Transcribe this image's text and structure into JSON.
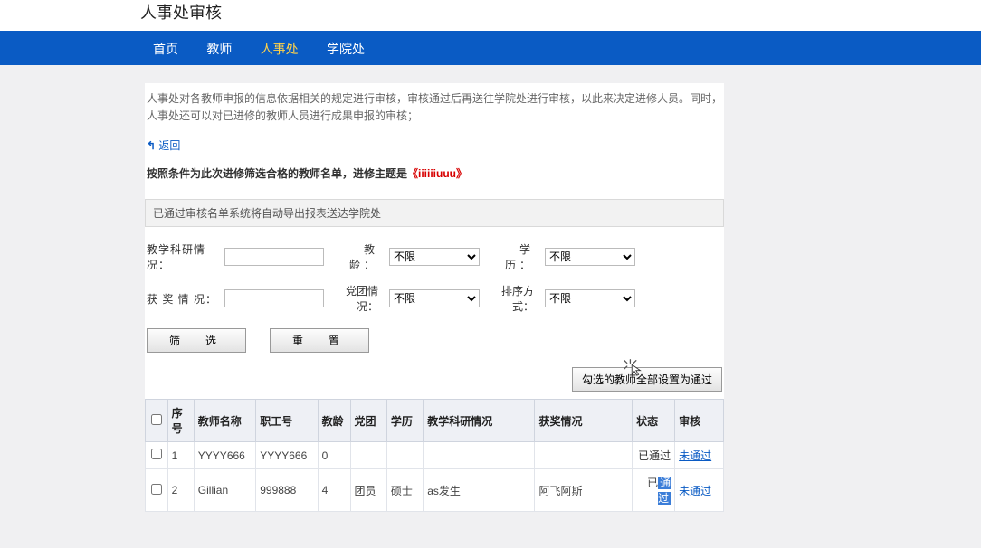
{
  "page_title": "人事处审核",
  "nav": [
    {
      "label": "首页",
      "active": false
    },
    {
      "label": "教师",
      "active": false
    },
    {
      "label": "人事处",
      "active": true
    },
    {
      "label": "学院处",
      "active": false
    }
  ],
  "description": "人事处对各教师申报的信息依据相关的规定进行审核，审核通过后再送往学院处进行审核，以此来决定进修人员。同时，人事处还可以对已进修的教师人员进行成果申报的审核；",
  "back_label": "返回",
  "rule_prefix": "按照条件为此次进修筛选合格的教师名单，进修主题是",
  "rule_highlight": "《iiiiiiuuu》",
  "note_line": "已通过审核名单系统将自动导出报表送达学院处",
  "filters": {
    "f1_label": "教学科研情况：",
    "f1_label2": "教　　龄：",
    "f1_value2": "不限",
    "f1_label3": "学　　历：",
    "f1_value3": "不限",
    "f2_label": "获 奖 情 况：",
    "f2_label2": "党团情况：",
    "f2_value2": "不限",
    "f2_label3": "排序方式：",
    "f2_value3": "不限"
  },
  "buttons": {
    "filter": "筛　选",
    "reset": "重　置",
    "set_pass": "勾选的教师全部设置为通过"
  },
  "table": {
    "headers": [
      "",
      "序号",
      "教师名称",
      "职工号",
      "教龄",
      "党团",
      "学历",
      "教学科研情况",
      "获奖情况",
      "状态",
      "审核"
    ],
    "rows": [
      {
        "idx": "1",
        "name": "YYYY666",
        "gh": "YYYY666",
        "age": "0",
        "dt": "",
        "xl": "",
        "jy": "",
        "hj": "",
        "status": "已通过",
        "audit": "未通过",
        "hl": false
      },
      {
        "idx": "2",
        "name": "Gillian",
        "gh": "999888",
        "age": "4",
        "dt": "团员",
        "xl": "硕士",
        "jy": "as发生",
        "hj": "阿飞阿斯",
        "status_prefix": "已",
        "status_hl": "通过",
        "audit": "未通过",
        "hl": true
      }
    ]
  }
}
